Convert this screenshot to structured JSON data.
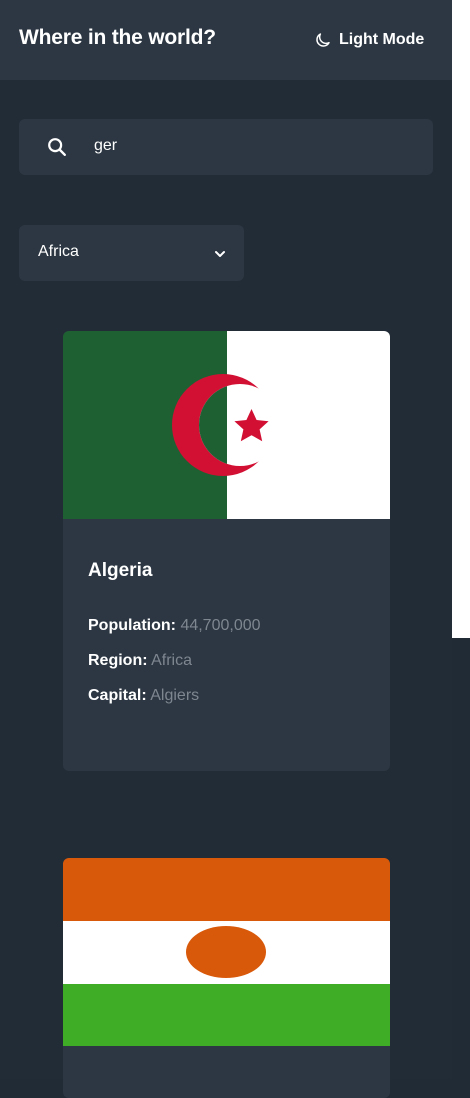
{
  "header": {
    "title": "Where in the world?",
    "mode_toggle_label": "Light Mode",
    "mode_icon": "moon-icon"
  },
  "search": {
    "icon": "search-icon",
    "value": "ger"
  },
  "filter": {
    "selected": "Africa",
    "icon": "chevron-down-icon"
  },
  "countries": [
    {
      "name": "Algeria",
      "population_label": "Population:",
      "population": "44,700,000",
      "region_label": "Region:",
      "region": "Africa",
      "capital_label": "Capital:",
      "capital": "Algiers",
      "flag": "algeria-flag"
    },
    {
      "flag": "niger-flag"
    }
  ],
  "colors": {
    "background": "#222c37",
    "element": "#2c3743",
    "text": "#ffffff",
    "muted_text": "#7e8690"
  }
}
